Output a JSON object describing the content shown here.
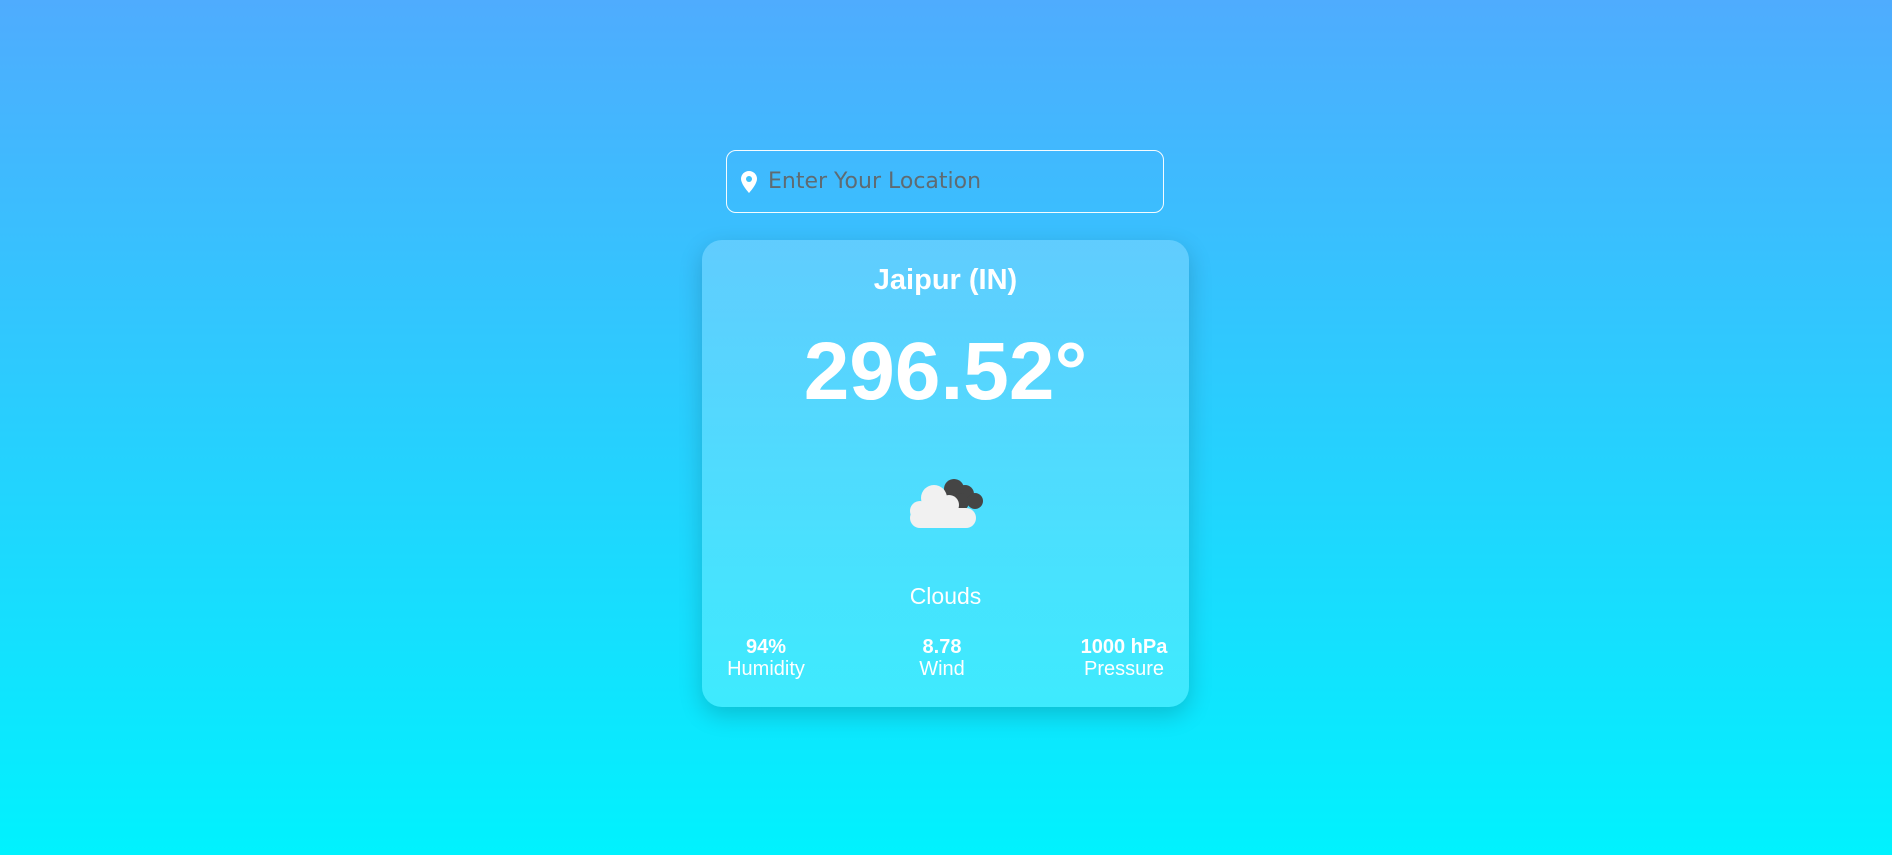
{
  "search": {
    "placeholder": "Enter Your Location",
    "icon": "location-pin-icon"
  },
  "weather": {
    "city": "Jaipur (IN)",
    "temperature": "296.52°",
    "icon": "clouds-icon",
    "condition": "Clouds",
    "stats": {
      "humidity_value": "94%",
      "humidity_label": "Humidity",
      "wind_value": "8.78",
      "wind_label": "Wind",
      "pressure_value": "1000 hPa",
      "pressure_label": "Pressure"
    }
  },
  "colors": {
    "gradient_top": "#4facfe",
    "gradient_bottom": "#00f2fe",
    "text": "#ffffff"
  }
}
